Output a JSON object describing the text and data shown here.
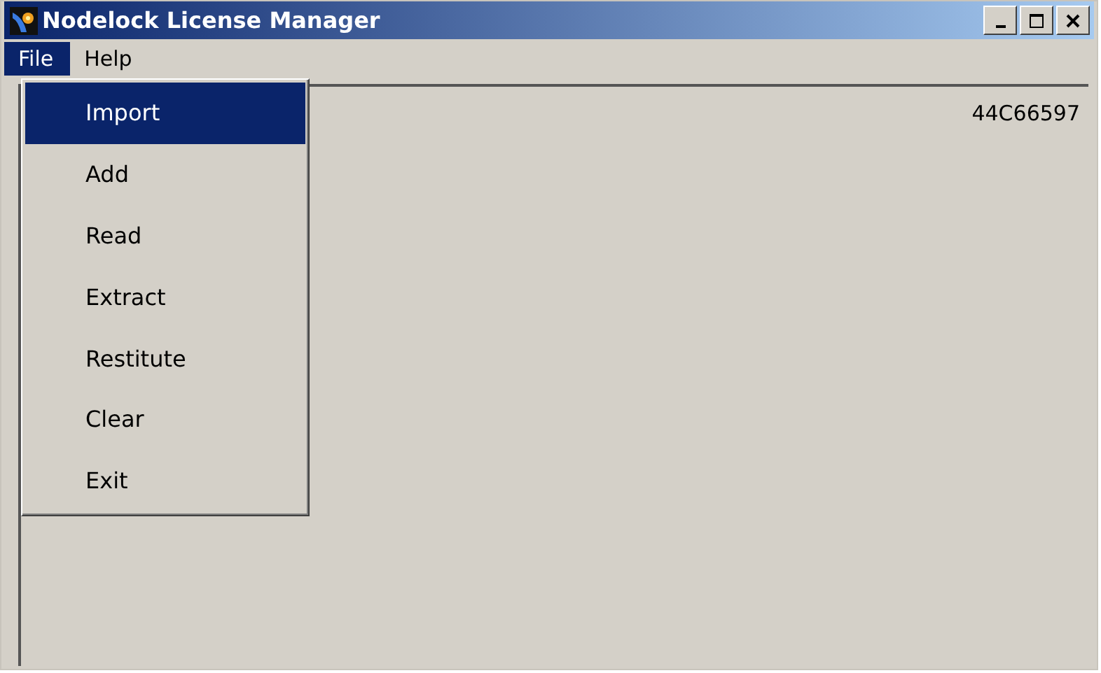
{
  "window": {
    "title": "Nodelock License Manager"
  },
  "menu_bar": [
    {
      "label": "File",
      "selected": true
    },
    {
      "label": "Help",
      "selected": false
    }
  ],
  "file_menu": [
    {
      "label": "Import",
      "selected": true
    },
    {
      "label": "Add",
      "selected": false
    },
    {
      "label": "Read",
      "selected": false
    },
    {
      "label": "Extract",
      "selected": false
    },
    {
      "label": "Restitute",
      "selected": false
    },
    {
      "label": "Clear",
      "selected": false
    },
    {
      "label": "Exit",
      "selected": false
    }
  ],
  "host_id": "44C66597"
}
